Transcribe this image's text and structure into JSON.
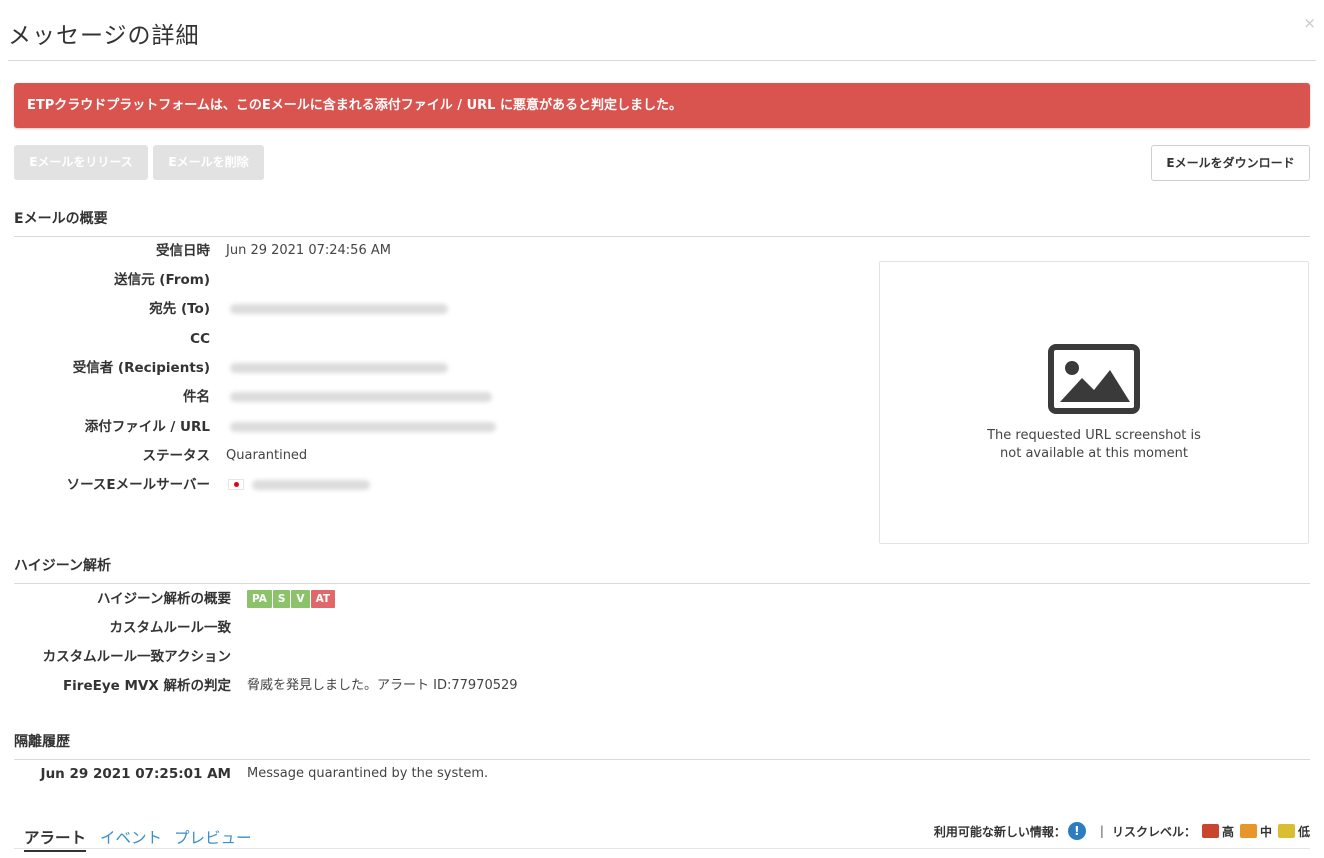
{
  "modal": {
    "title": "メッセージの詳細",
    "close_label": "×"
  },
  "banner": {
    "text": "ETPクラウドプラットフォームは、このEメールに含まれる添付ファイル / URL に悪意があると判定しました。",
    "color": "#d9534f"
  },
  "actions": {
    "release_label": "Eメールをリリース",
    "delete_label": "Eメールを削除",
    "download_label": "Eメールをダウンロード"
  },
  "overview": {
    "title": "Eメールの概要",
    "fields": {
      "received": {
        "label": "受信日時",
        "value": "Jun 29 2021 07:24:56 AM"
      },
      "from": {
        "label": "送信元 (From)",
        "value": ""
      },
      "to": {
        "label": "宛先 (To)"
      },
      "cc": {
        "label": "CC",
        "value": ""
      },
      "recipients": {
        "label": "受信者 (Recipients)"
      },
      "subject": {
        "label": "件名"
      },
      "attachment": {
        "label": "添付ファイル / URL"
      },
      "status": {
        "label": "ステータス",
        "value": "Quarantined"
      },
      "source_server": {
        "label": "ソースEメールサーバー",
        "flag": "jp-flag-icon"
      }
    },
    "screenshot": {
      "icon": "image-placeholder-icon",
      "line1": "The requested URL screenshot is",
      "line2": "not available at this moment"
    }
  },
  "hygiene": {
    "title": "ハイジーン解析",
    "summary_label": "ハイジーン解析の概要",
    "badges": [
      {
        "text": "PA",
        "color": "green"
      },
      {
        "text": "S",
        "color": "green"
      },
      {
        "text": "V",
        "color": "green"
      },
      {
        "text": "AT",
        "color": "red"
      }
    ],
    "custom_rule_label": "カスタムルール一致",
    "custom_rule_action_label": "カスタムルール一致アクション",
    "mvx_label": "FireEye MVX 解析の判定",
    "mvx_value": "脅威を発見しました。アラート ID:77970529"
  },
  "quarantine": {
    "title": "隔離履歴",
    "entry_time": "Jun 29 2021 07:25:01 AM",
    "entry_text": "Message quarantined by the system."
  },
  "tabs": [
    {
      "label": "アラート",
      "active": true
    },
    {
      "label": "イベント",
      "active": false
    },
    {
      "label": "プレビュー",
      "active": false
    }
  ],
  "legend": {
    "new_info_label": "利用可能な新しい情報：",
    "info_icon": "!",
    "separator": "|",
    "risk_label": "リスクレベル：",
    "high": {
      "label": "高",
      "color": "#c9452e"
    },
    "medium": {
      "label": "中",
      "color": "#e8962b"
    },
    "low": {
      "label": "低",
      "color": "#d9be34"
    }
  }
}
